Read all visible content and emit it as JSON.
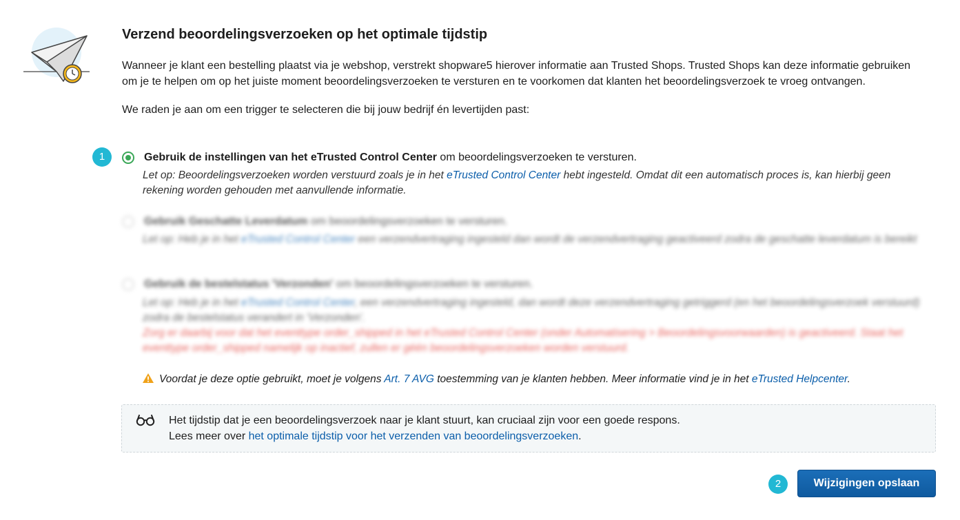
{
  "header": {
    "title": "Verzend beoordelingsverzoeken op het optimale tijdstip"
  },
  "intro": "Wanneer je klant een bestelling plaatst via je webshop, verstrekt shopware5 hierover informatie aan Trusted Shops. Trusted Shops kan deze informatie gebruiken om je te helpen om op het juiste moment beoordelingsverzoeken te versturen en te voorkomen dat klanten het beoordelingsverzoek te vroeg ontvangen.",
  "recommendation": "We raden je aan om een trigger te selecteren die bij jouw bedrijf én levertijden past:",
  "options": [
    {
      "title_bold": "Gebruik de instellingen van het eTrusted Control Center",
      "title_rest": " om beoordelingsverzoeken te versturen.",
      "note_prefix": "Let op: Beoordelingsverzoeken worden verstuurd zoals je in het ",
      "note_link": "eTrusted Control Center",
      "note_suffix": " hebt ingesteld. Omdat dit een automatisch proces is, kan hierbij geen rekening worden gehouden met aanvullende informatie.",
      "checked": true
    },
    {
      "title_bold": "Gebruik Geschatte Leverdatum",
      "title_rest": " om beoordelingsverzoeken te versturen.",
      "note_prefix": "Let op: Heb je in het ",
      "note_link": "eTrusted Control Center",
      "note_suffix": " een verzendvertraging ingesteld dan wordt de verzendvertraging geactiveerd zodra de geschatte leverdatum is bereikt",
      "checked": false
    },
    {
      "title_bold": "Gebruik de bestelstatus 'Verzonden'",
      "title_rest": " om beoordelingsverzoeken te versturen.",
      "note_prefix": "Let op: Heb je in het ",
      "note_link": "eTrusted Control Center",
      "note_suffix": ", een verzendvertraging ingesteld, dan wordt deze verzendvertraging getriggerd (en het beoordelingsverzoek verstuurd) zodra de bestelstatus verandert in 'Verzonden'.",
      "note_red": "Zorg er daarbij voor dat het eventtype order_shipped in het eTrusted Control Center (onder Automatisering > Beoordelingsvoorwaarden) is geactiveerd. Staat het eventtype order_shipped namelijk op inactief, zullen er géén beoordelingsverzoeken worden verstuurd.",
      "checked": false
    }
  ],
  "warning": {
    "prefix": "Voordat je deze optie gebruikt, moet je volgens ",
    "link1": "Art. 7 AVG",
    "middle": " toestemming van je klanten hebben. Meer informatie vind je in het ",
    "link2": "eTrusted Helpcenter",
    "suffix": "."
  },
  "infobox": {
    "line1": "Het tijdstip dat je een beoordelingsverzoek naar je klant stuurt, kan cruciaal zijn voor een goede respons.",
    "line2_prefix": "Lees meer over ",
    "line2_link": "het optimale tijdstip voor het verzenden van beoordelingsverzoeken",
    "line2_suffix": "."
  },
  "badges": {
    "step1": "1",
    "step2": "2"
  },
  "save_button": "Wijzigingen opslaan",
  "icons": {
    "illustration": "paper-plane-clock-icon",
    "warning": "warning-triangle-icon",
    "infobox": "glasses-icon"
  },
  "colors": {
    "accent_green": "#3aa757",
    "link_blue": "#0b5eaa",
    "badge_cyan": "#22b8d4",
    "button_blue": "#1464ab",
    "warning_orange": "#f0a21a",
    "error_red": "#e0312b"
  }
}
